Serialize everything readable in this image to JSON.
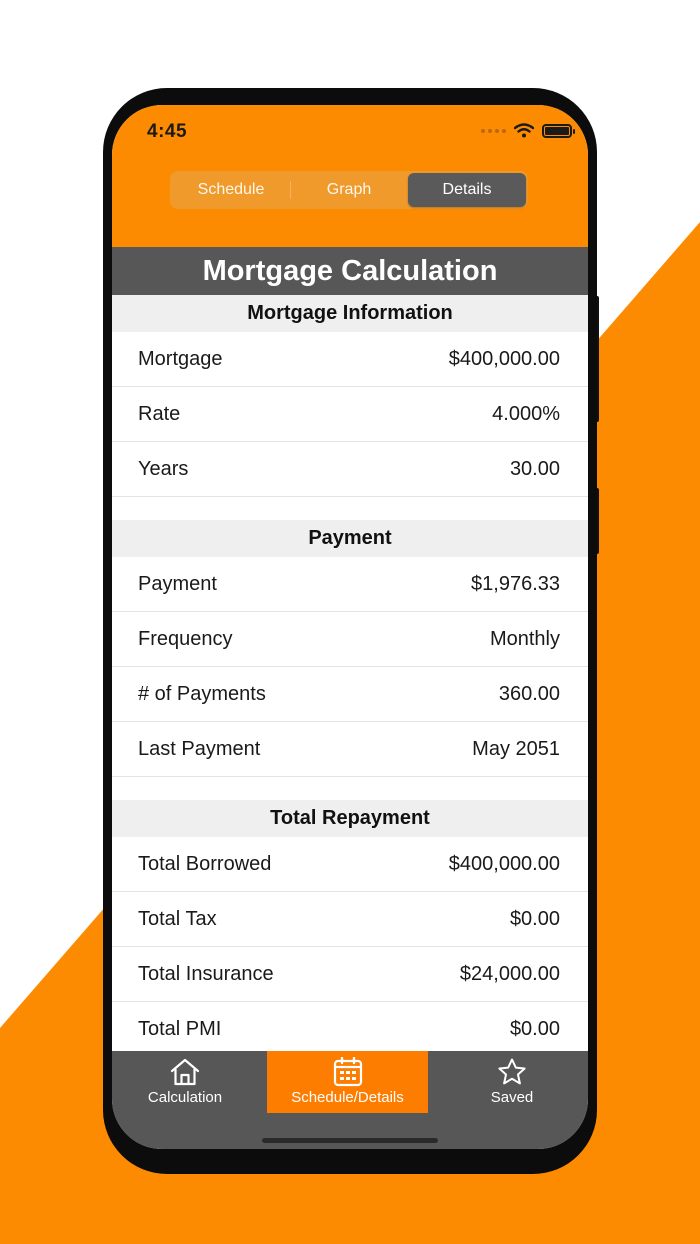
{
  "status_bar": {
    "time": "4:45"
  },
  "segments": [
    {
      "label": "Schedule",
      "active": false
    },
    {
      "label": "Graph",
      "active": false
    },
    {
      "label": "Details",
      "active": true
    }
  ],
  "page_title": "Mortgage Calculation",
  "sections": {
    "mortgage_info": {
      "header": "Mortgage Information",
      "rows": [
        {
          "label": "Mortgage",
          "value": "$400,000.00"
        },
        {
          "label": "Rate",
          "value": "4.000%"
        },
        {
          "label": "Years",
          "value": "30.00"
        }
      ]
    },
    "payment": {
      "header": "Payment",
      "rows": [
        {
          "label": "Payment",
          "value": "$1,976.33"
        },
        {
          "label": "Frequency",
          "value": "Monthly"
        },
        {
          "label": "# of Payments",
          "value": "360.00"
        },
        {
          "label": "Last Payment",
          "value": "May 2051"
        }
      ]
    },
    "total_repayment": {
      "header": "Total Repayment",
      "rows": [
        {
          "label": "Total Borrowed",
          "value": "$400,000.00"
        },
        {
          "label": "Total Tax",
          "value": "$0.00"
        },
        {
          "label": "Total Insurance",
          "value": "$24,000.00"
        },
        {
          "label": "Total PMI",
          "value": "$0.00"
        }
      ]
    }
  },
  "tabbar": [
    {
      "label": "Calculation",
      "icon": "home-icon",
      "active": false
    },
    {
      "label": "Schedule/Details",
      "icon": "calendar-icon",
      "active": true
    },
    {
      "label": "Saved",
      "icon": "star-icon",
      "active": false
    }
  ],
  "colors": {
    "accent_orange": "#fd8b02",
    "title_gray": "#575757",
    "active_tab_orange": "#fd7d00"
  }
}
